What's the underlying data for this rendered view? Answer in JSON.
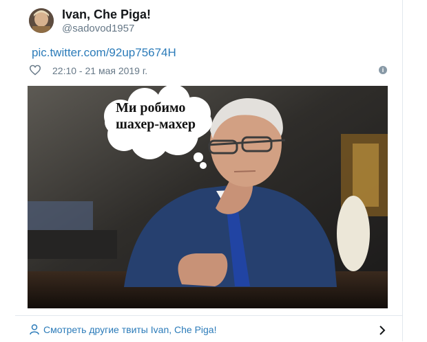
{
  "tweet": {
    "display_name": "Ivan, Che Piga!",
    "handle": "@sadovod1957",
    "link": "pic.twitter.com/92up75674H",
    "timestamp": "22:10 - 21 мая 2019 г.",
    "image": {
      "speech_bubble_line1": "Ми робимо",
      "speech_bubble_line2": "шахер-махер"
    }
  },
  "footer": {
    "more_tweets_label": "Смотреть другие твиты Ivan, Che Piga!"
  },
  "icons": {
    "heart": "heart-icon",
    "info": "info-icon",
    "user": "user-icon",
    "chevron": "chevron-right-icon"
  },
  "colors": {
    "link": "#2b7bb9",
    "muted": "#657786",
    "border": "#e1e8ed"
  }
}
